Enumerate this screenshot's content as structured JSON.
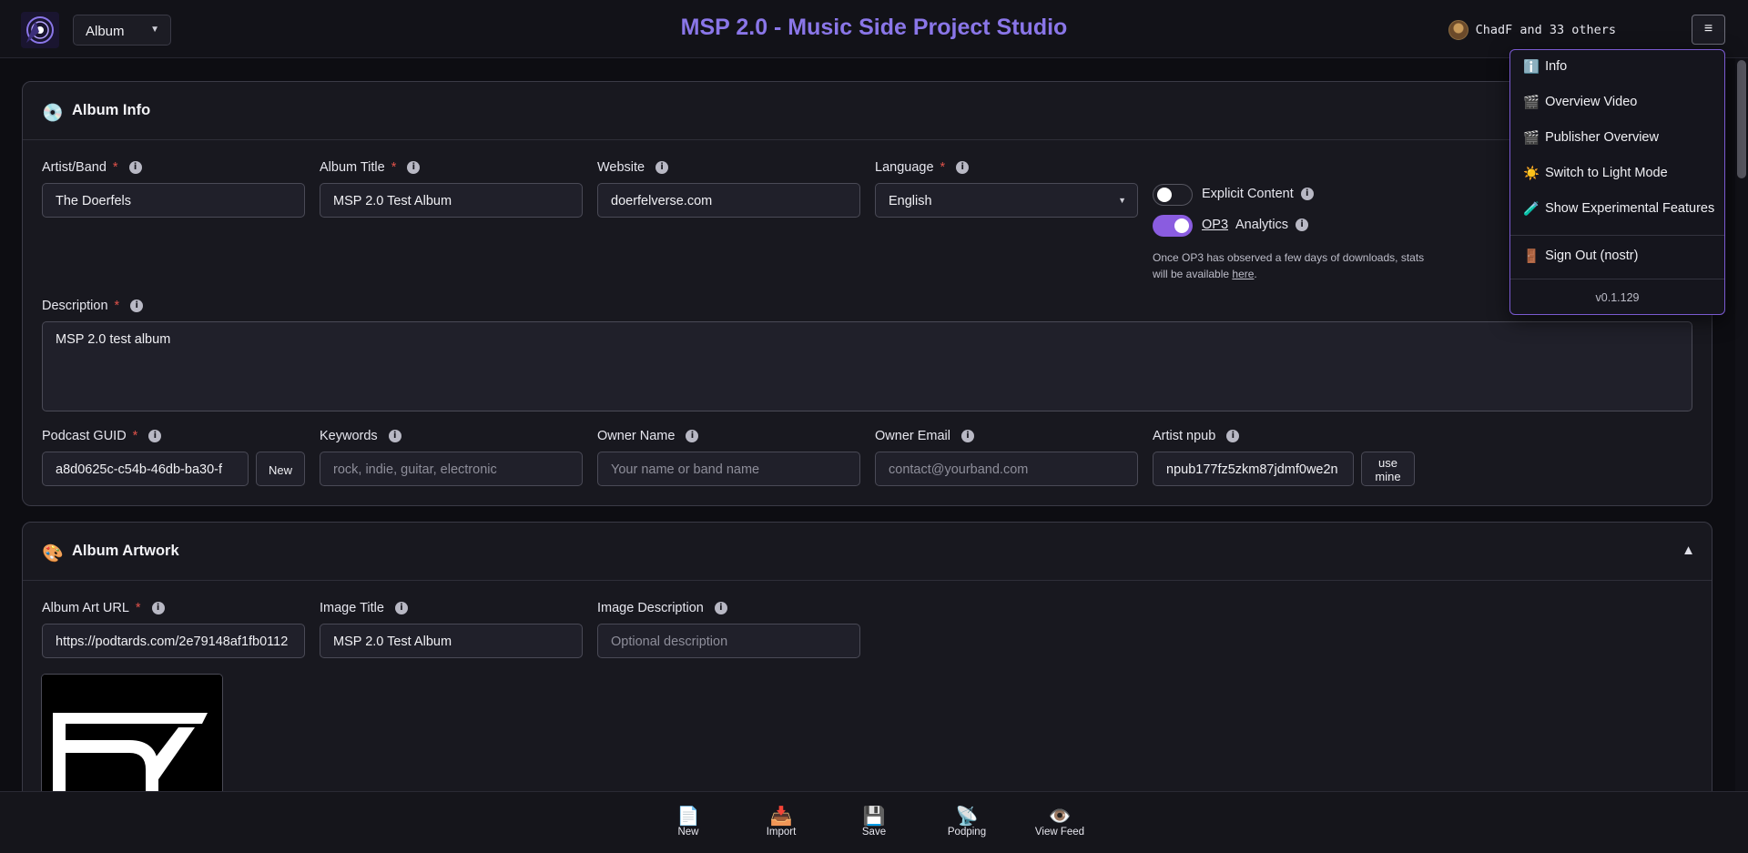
{
  "header": {
    "mode_select": "Album",
    "title": "MSP 2.0 - Music Side Project Studio",
    "user_label": "ChadF and 33 others",
    "menu_glyph": "≡"
  },
  "menu": {
    "items": [
      {
        "icon": "ℹ️",
        "label": "Info"
      },
      {
        "icon": "🎬",
        "label": "Overview Video"
      },
      {
        "icon": "🎬",
        "label": "Publisher Overview"
      },
      {
        "icon": "☀️",
        "label": "Switch to Light Mode"
      },
      {
        "icon": "🧪",
        "label": "Show Experimental Features"
      },
      {
        "icon": "🚪",
        "label": "Sign Out (nostr)"
      }
    ],
    "version": "v0.1.129"
  },
  "album_info": {
    "icon": "💿",
    "title": "Album Info",
    "artist_label": "Artist/Band",
    "artist_value": "The Doerfels",
    "album_title_label": "Album Title",
    "album_title_value": "MSP 2.0 Test Album",
    "website_label": "Website",
    "website_value": "doerfelverse.com",
    "language_label": "Language",
    "language_value": "English",
    "explicit_label": "Explicit Content",
    "explicit_on": false,
    "op3_link": "OP3",
    "analytics_label": "Analytics",
    "analytics_on": true,
    "op3_help_prefix": "Once OP3 has observed a few days of downloads, stats will be available ",
    "op3_help_link": "here",
    "op3_help_suffix": ".",
    "description_label": "Description",
    "description_value": "MSP 2.0 test album",
    "guid_label": "Podcast GUID",
    "guid_value": "a8d0625c-c54b-46db-ba30-f",
    "guid_new_button": "New",
    "keywords_label": "Keywords",
    "keywords_placeholder": "rock, indie, guitar, electronic",
    "owner_name_label": "Owner Name",
    "owner_name_placeholder": "Your name or band name",
    "owner_email_label": "Owner Email",
    "owner_email_placeholder": "contact@yourband.com",
    "npub_label": "Artist npub",
    "npub_value": "npub177fz5zkm87jdmf0we2n",
    "use_mine_line1": "use",
    "use_mine_line2": "mine"
  },
  "album_artwork": {
    "icon": "🎨",
    "title": "Album Artwork",
    "collapse_glyph": "▲",
    "art_url_label": "Album Art URL",
    "art_url_value": "https://podtards.com/2e79148af1fb0112",
    "image_title_label": "Image Title",
    "image_title_value": "MSP 2.0 Test Album",
    "image_desc_label": "Image Description",
    "image_desc_placeholder": "Optional description"
  },
  "bottom_bar": [
    {
      "icon": "📄",
      "label": "New"
    },
    {
      "icon": "📥",
      "label": "Import"
    },
    {
      "icon": "💾",
      "label": "Save"
    },
    {
      "icon": "📡",
      "label": "Podping"
    },
    {
      "icon": "👁️",
      "label": "View Feed"
    }
  ],
  "colors": {
    "accent": "#8a76e8",
    "toggle_on": "#8a5ce0",
    "required": "#e0524a",
    "background": "#0d0d12"
  }
}
